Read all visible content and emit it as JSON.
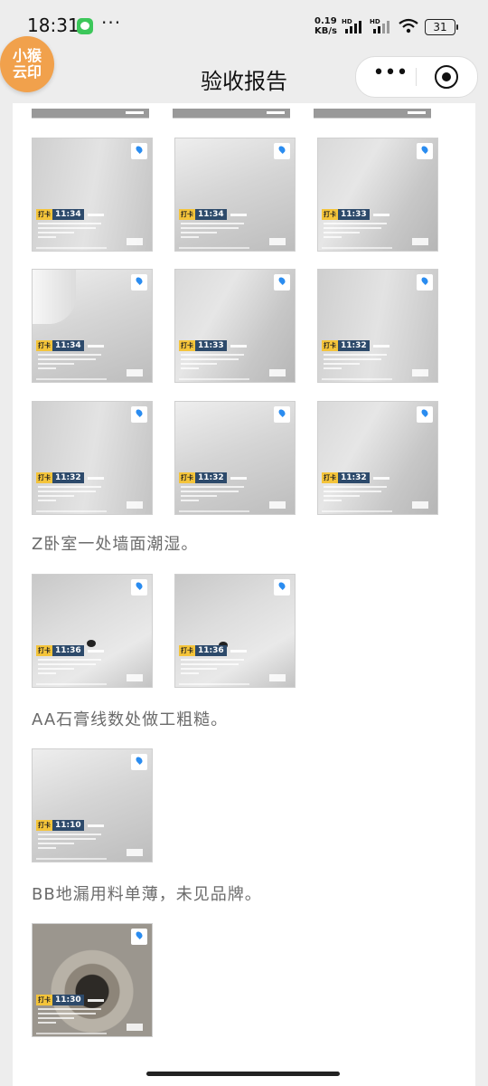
{
  "status_bar": {
    "time": "18:31",
    "network_speed": "0.19",
    "network_speed_unit": "KB/s",
    "hd_label": "HD",
    "battery": "31"
  },
  "header": {
    "title": "验收报告",
    "logo_line1": "小猴",
    "logo_line2": "云印"
  },
  "photo_groups": [
    {
      "caption": "",
      "photos": [
        {
          "time": "11:34",
          "tag": "打卡"
        },
        {
          "time": "11:34",
          "tag": "打卡"
        },
        {
          "time": "11:33",
          "tag": "打卡"
        },
        {
          "time": "11:34",
          "tag": "打卡"
        },
        {
          "time": "11:33",
          "tag": "打卡"
        },
        {
          "time": "11:32",
          "tag": "打卡"
        },
        {
          "time": "11:32",
          "tag": "打卡"
        },
        {
          "time": "11:32",
          "tag": "打卡"
        },
        {
          "time": "11:32",
          "tag": "打卡"
        }
      ]
    },
    {
      "caption": "Z卧室一处墙面潮湿。",
      "photos": [
        {
          "time": "11:36",
          "tag": "打卡"
        },
        {
          "time": "11:36",
          "tag": "打卡"
        }
      ]
    },
    {
      "caption": "AA石膏线数处做工粗糙。",
      "photos": [
        {
          "time": "11:10",
          "tag": "打卡"
        }
      ]
    },
    {
      "caption": "BB地漏用料单薄，未见品牌。",
      "photos": [
        {
          "time": "11:30",
          "tag": "打卡"
        }
      ]
    }
  ]
}
